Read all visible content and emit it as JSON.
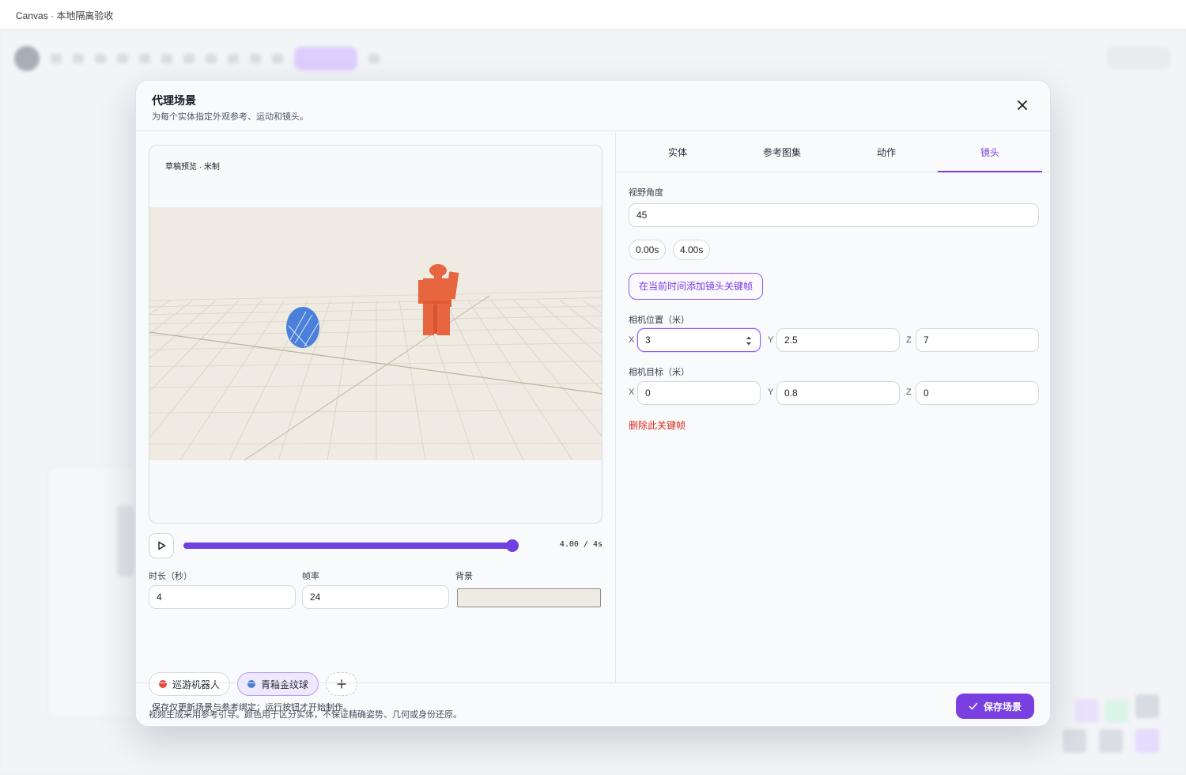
{
  "window": {
    "title": "Canvas · 本地隔离验收"
  },
  "modal": {
    "title": "代理场景",
    "subtitle": "为每个实体指定外观参考、运动和镜头。",
    "preview": {
      "label": "草稿预览 · 米制"
    },
    "transport": {
      "time_readout": "4.00 / 4s",
      "progress": 1.0
    },
    "settings": {
      "duration_label": "时长（秒）",
      "duration_value": "4",
      "fps_label": "帧率",
      "fps_value": "24",
      "background_label": "背景",
      "background_color": "#efebe2"
    },
    "entities": [
      {
        "name": "巡游机器人",
        "color": "#e74c3c",
        "active": false
      },
      {
        "name": "青釉金纹球",
        "color": "#4a80d9",
        "active": true
      }
    ],
    "note": "视频生成采用参考引导。颜色用于区分实体，不保证精确姿势、几何或身份还原。",
    "tabs": [
      {
        "label": "实体",
        "active": false
      },
      {
        "label": "参考图集",
        "active": false
      },
      {
        "label": "动作",
        "active": false
      },
      {
        "label": "镜头",
        "active": true
      }
    ],
    "camera": {
      "fov_label": "视野角度",
      "fov_value": "45",
      "keyframe_times": [
        "0.00s",
        "4.00s"
      ],
      "add_keyframe_label": "在当前时间添加镜头关键帧",
      "position_label": "相机位置（米）",
      "position": {
        "x": "3",
        "y": "2.5",
        "z": "7"
      },
      "target_label": "相机目标（米）",
      "target": {
        "x": "0",
        "y": "0.8",
        "z": "0"
      },
      "axis_labels": {
        "x": "X",
        "y": "Y",
        "z": "Z"
      },
      "delete_label": "删除此关键帧"
    },
    "footer": {
      "note": "保存仅更新场景与参考绑定；运行按钮才开始制作。",
      "save_label": "保存场景"
    }
  },
  "colors": {
    "accent": "#7a3fe0",
    "danger": "#d92d20",
    "robot": "#e8663f",
    "ball": "#4a80d9"
  },
  "icons": {
    "close": "close-icon",
    "play": "play-icon",
    "check": "check-icon",
    "add": "plus-icon",
    "spinner": "spin-arrows-icon"
  }
}
